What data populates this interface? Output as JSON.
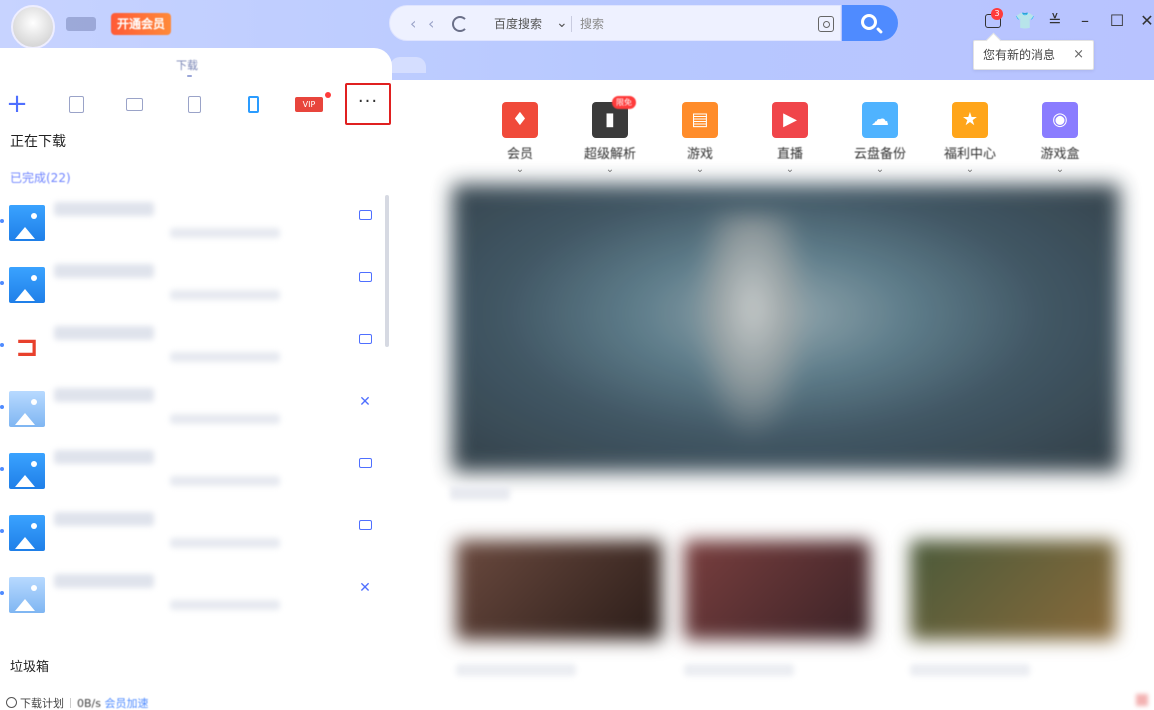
{
  "header": {
    "vip_label": "开通会员",
    "address": {
      "engine": "百度搜索",
      "search_placeholder": "搜索",
      "nav_back": "‹",
      "nav_forward": "‹"
    },
    "message_count": "3",
    "tooltip": {
      "text": "您有新的消息",
      "close": "×"
    }
  },
  "left_panel": {
    "tab_label": "下载",
    "toolbar": {
      "add": "+",
      "more": "···",
      "vip_tag": "VIP"
    },
    "section_title": "正在下载",
    "done_label": "已完成(22)",
    "items": [
      {
        "icon": "image-file-icon",
        "action": "folder-icon"
      },
      {
        "icon": "image-file-icon",
        "action": "folder-icon"
      },
      {
        "icon": "office-file-icon",
        "action": "folder-icon"
      },
      {
        "icon": "image-file-icon",
        "action": "delete-icon"
      },
      {
        "icon": "image-file-icon",
        "action": "folder-icon"
      },
      {
        "icon": "image-file-icon",
        "action": "folder-icon"
      },
      {
        "icon": "image-file-icon",
        "action": "delete-icon"
      }
    ],
    "action_glyph_delete": "✕",
    "trash_label": "垃圾箱",
    "footer": {
      "plan_label": "下载计划",
      "speed_label": "0B/s",
      "accel_label": "会员加速"
    }
  },
  "categories": [
    {
      "label": "会员",
      "color": "#f04a3a",
      "glyph": "♦"
    },
    {
      "label": "超级解析",
      "color": "#3b3b3b",
      "glyph": "▮",
      "badge": "限免"
    },
    {
      "label": "游戏",
      "color": "#ff8c2a",
      "glyph": "▤"
    },
    {
      "label": "直播",
      "color": "#f0454a",
      "glyph": "▶"
    },
    {
      "label": "云盘备份",
      "color": "#4fb3ff",
      "glyph": "☁"
    },
    {
      "label": "福利中心",
      "color": "#ffa51a",
      "glyph": "★"
    },
    {
      "label": "游戏盒",
      "color": "#8a7cff",
      "glyph": "◉"
    }
  ],
  "colors": {
    "accent": "#4f8bff",
    "highlight_border": "#e02020"
  }
}
